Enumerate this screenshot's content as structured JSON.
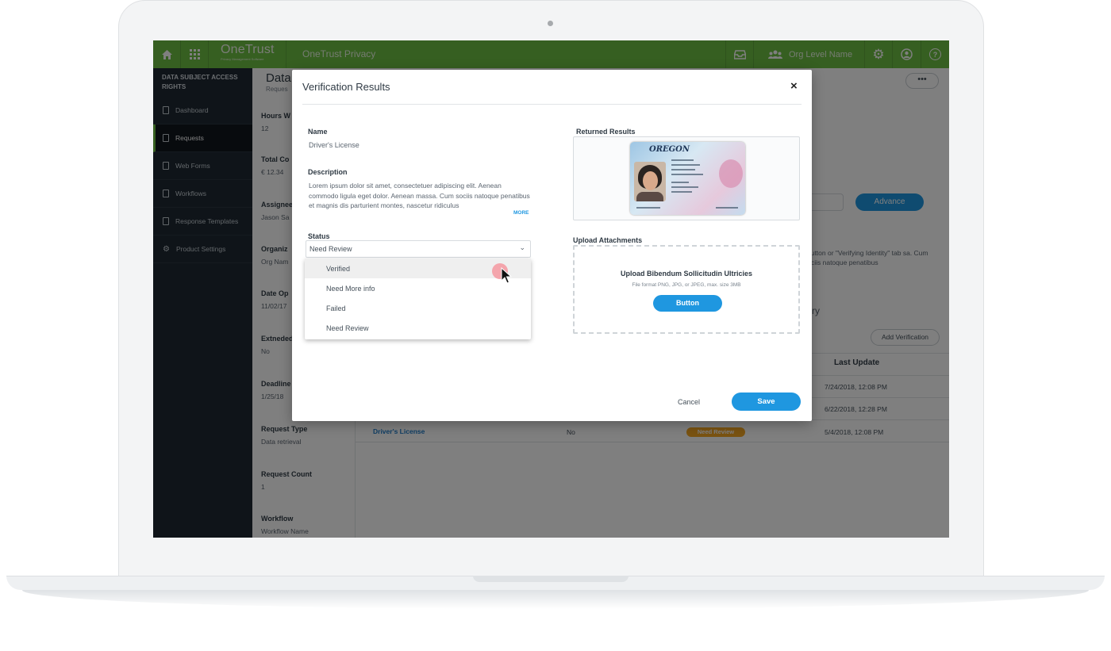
{
  "app": {
    "logo": "OneTrust",
    "logo_tagline": "Privacy Management Software",
    "product": "OneTrust Privacy",
    "org_level": "Org Level Name"
  },
  "icons": {
    "home": "home-icon",
    "apps": "apps-grid-icon",
    "inbox": "inbox-icon",
    "users": "users-icon",
    "settings": "gear-icon",
    "profile": "user-circle-icon",
    "help": "help-icon"
  },
  "colors": {
    "brand_green": "#6cbf43",
    "sidebar_bg": "#1f2933",
    "accent_blue": "#1f97e0",
    "status_orange": "#f5a623"
  },
  "sidebar": {
    "title": "DATA SUBJECT ACCESS RIGHTS",
    "items": [
      {
        "label": "Dashboard"
      },
      {
        "label": "Requests"
      },
      {
        "label": "Web Forms"
      },
      {
        "label": "Workflows"
      },
      {
        "label": "Response Templates"
      },
      {
        "label": "Product Settings"
      }
    ]
  },
  "page": {
    "title_partial": "Data",
    "subtitle_partial": "Reques",
    "fields": [
      {
        "label": "Hours W",
        "value": "12"
      },
      {
        "label": "Total Co",
        "value": "€ 12.34"
      },
      {
        "label": "Assignee",
        "value": "Jason Sa"
      },
      {
        "label": "Organiz",
        "value": "Org Nam"
      },
      {
        "label": "Date Op",
        "value": "11/02/17"
      },
      {
        "label": "Extneded",
        "value": "No"
      },
      {
        "label": "Deadline",
        "value": "1/25/18"
      },
      {
        "label": "Request Type",
        "value": "Data retrieval"
      },
      {
        "label": "Request Count",
        "value": "1"
      },
      {
        "label": "Workflow",
        "value": "Workflow Name"
      }
    ],
    "more_label": "•••",
    "advance_label": "Advance",
    "background_text": "' button or \"Verifying Identity\" tab sa. Cum sociis natoque penatibus",
    "partial_heading": "ry",
    "add_verification_label": "Add Verification",
    "table": {
      "last_update_header": "Last Update",
      "rows": [
        {
          "last_update": "7/24/2018, 12:08 PM"
        },
        {
          "last_update": "6/22/2018, 12:28 PM"
        },
        {
          "name": "Driver's License",
          "flag": "No",
          "status": "Need Review",
          "last_update": "5/4/2018, 12:08 PM"
        }
      ]
    }
  },
  "modal": {
    "title": "Verification Results",
    "close_label": "×",
    "name_label": "Name",
    "name_value": "Driver's License",
    "description_label": "Description",
    "description_value": "Lorem ipsum dolor sit amet, consectetuer adipiscing elit. Aenean commodo ligula eget dolor. Aenean massa. Cum sociis natoque penatibus et magnis dis parturient montes, nascetur ridiculus",
    "more_label": "MORE",
    "status_label": "Status",
    "status_value": "Need Review",
    "status_options": [
      "Verified",
      "Need More info",
      "Failed",
      "Need Review"
    ],
    "returned_results_label": "Returned Results",
    "id_card_state": "OREGON",
    "upload_label": "Upload Attachments",
    "upload_title": "Upload Bibendum Sollicitudin Ultricies",
    "upload_hint": "File format PNG, JPG, or JPEG, max. size 3MB",
    "upload_button": "Button",
    "cancel_label": "Cancel",
    "save_label": "Save"
  }
}
